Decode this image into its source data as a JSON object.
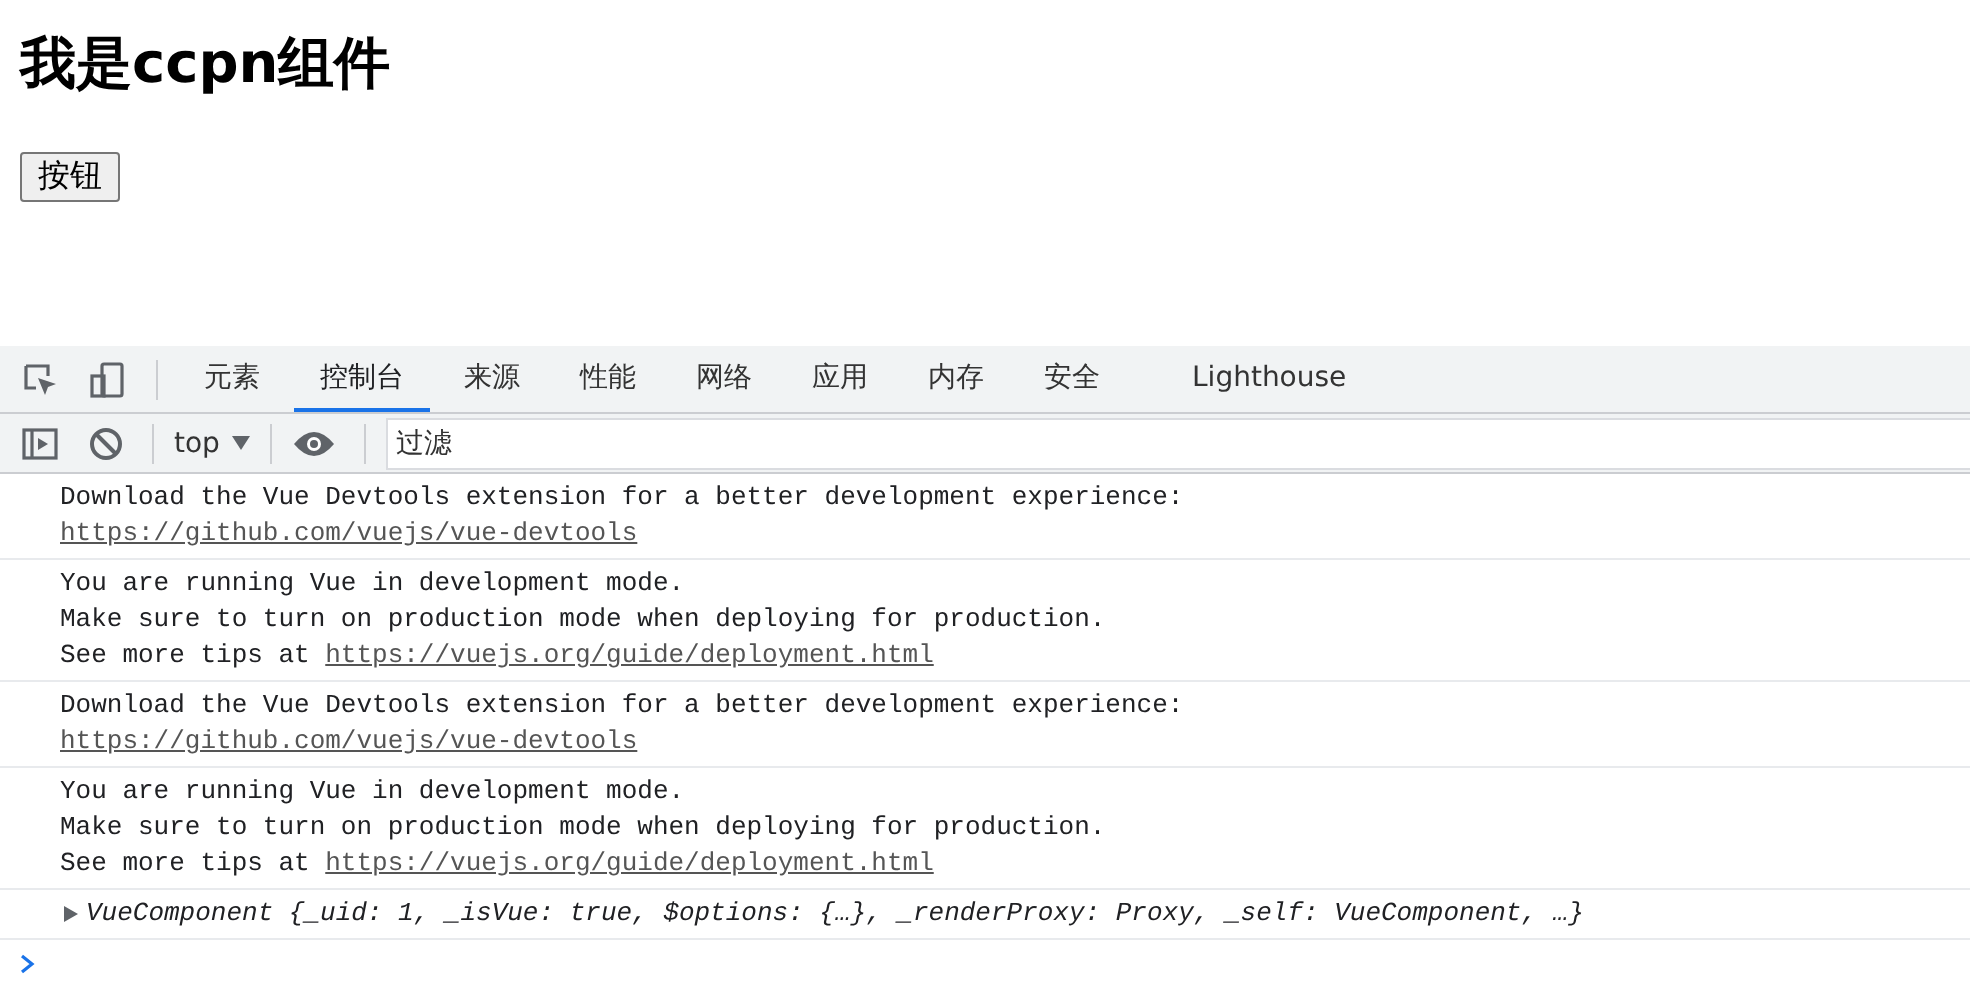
{
  "page": {
    "heading": "我是ccpn组件",
    "button": "按钮"
  },
  "devtools": {
    "tabs": [
      {
        "label": "元素",
        "selected": false
      },
      {
        "label": "控制台",
        "selected": true
      },
      {
        "label": "来源",
        "selected": false
      },
      {
        "label": "性能",
        "selected": false
      },
      {
        "label": "网络",
        "selected": false
      },
      {
        "label": "应用",
        "selected": false
      },
      {
        "label": "内存",
        "selected": false
      },
      {
        "label": "安全",
        "selected": false
      },
      {
        "label": "Lighthouse",
        "selected": false
      }
    ],
    "toolbar": {
      "context": "top",
      "filter": {
        "placeholder": "过滤"
      }
    },
    "messages": [
      {
        "kind": "log",
        "lines": [
          {
            "text": "Download the Vue Devtools extension for a better development experience:"
          },
          {
            "link": "https://github.com/vuejs/vue-devtools"
          }
        ]
      },
      {
        "kind": "log",
        "lines": [
          {
            "text": "You are running Vue in development mode."
          },
          {
            "text": "Make sure to turn on production mode when deploying for production."
          },
          {
            "text": "See more tips at ",
            "link": "https://vuejs.org/guide/deployment.html"
          }
        ]
      },
      {
        "kind": "log",
        "lines": [
          {
            "text": "Download the Vue Devtools extension for a better development experience:"
          },
          {
            "link": "https://github.com/vuejs/vue-devtools"
          }
        ]
      },
      {
        "kind": "log",
        "lines": [
          {
            "text": "You are running Vue in development mode."
          },
          {
            "text": "Make sure to turn on production mode when deploying for production."
          },
          {
            "text": "See more tips at ",
            "link": "https://vuejs.org/guide/deployment.html"
          }
        ]
      },
      {
        "kind": "object",
        "expanded": false,
        "text": "VueComponent {_uid: 1, _isVue: true, $options: {…}, _renderProxy: Proxy, _self: VueComponent, …}"
      }
    ]
  }
}
